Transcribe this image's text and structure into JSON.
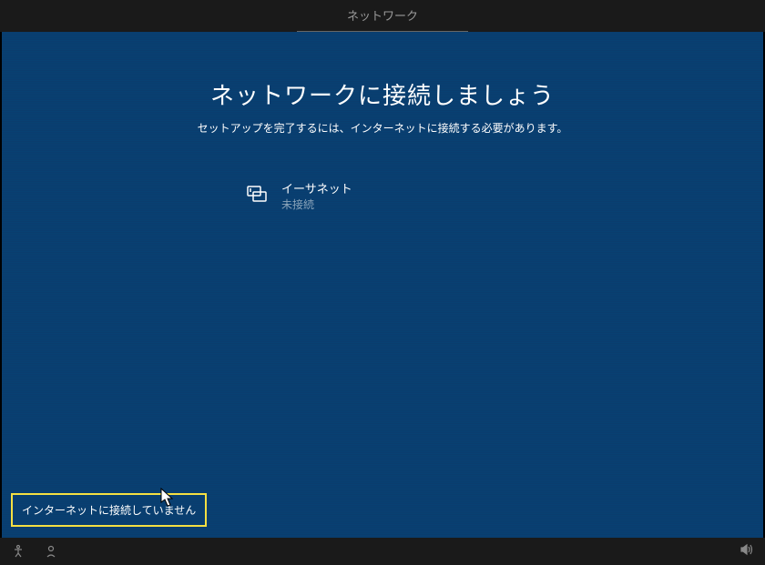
{
  "header": {
    "tab_label": "ネットワーク"
  },
  "main": {
    "title": "ネットワークに接続しましょう",
    "subtitle": "セットアップを完了するには、インターネットに接続する必要があります。",
    "networks": [
      {
        "name": "イーサネット",
        "status": "未接続"
      }
    ]
  },
  "buttons": {
    "skip_internet": "インターネットに接続していません"
  }
}
